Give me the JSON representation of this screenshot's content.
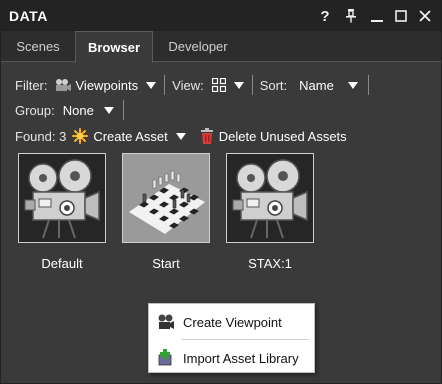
{
  "window": {
    "title": "DATA",
    "controls": [
      "?",
      "pin",
      "minimize",
      "maximize",
      "close"
    ]
  },
  "tabs": [
    {
      "label": "Scenes",
      "active": false
    },
    {
      "label": "Browser",
      "active": true
    },
    {
      "label": "Developer",
      "active": false
    }
  ],
  "toolbar": {
    "filter_label": "Filter:",
    "filter_value": "Viewpoints",
    "filter_icon": "camera-icon",
    "view_label": "View:",
    "view_icon": "grid-view-icon",
    "sort_label": "Sort:",
    "sort_value": "Name",
    "group_label": "Group:",
    "group_value": "None",
    "found_label": "Found: 3",
    "create_asset_label": "Create Asset",
    "create_asset_icon": "sparkle-icon",
    "delete_unused_label": "Delete Unused Assets",
    "delete_unused_icon": "trash-icon"
  },
  "assets": [
    {
      "label": "Default",
      "icon": "movie-camera-icon"
    },
    {
      "label": "Start",
      "icon": "chessboard-thumbnail"
    },
    {
      "label": "STAX:1",
      "icon": "movie-camera-icon"
    }
  ],
  "context_menu": {
    "items": [
      {
        "label": "Create Viewpoint",
        "icon": "camera-icon"
      },
      {
        "label": "Import Asset Library",
        "icon": "import-plus-icon"
      }
    ]
  },
  "colors": {
    "window_bg": "#3a3a3a",
    "titlebar_bg": "#232323",
    "sparkle": "#ffb020",
    "trash": "#d93a3a",
    "plus": "#2fa52f"
  }
}
